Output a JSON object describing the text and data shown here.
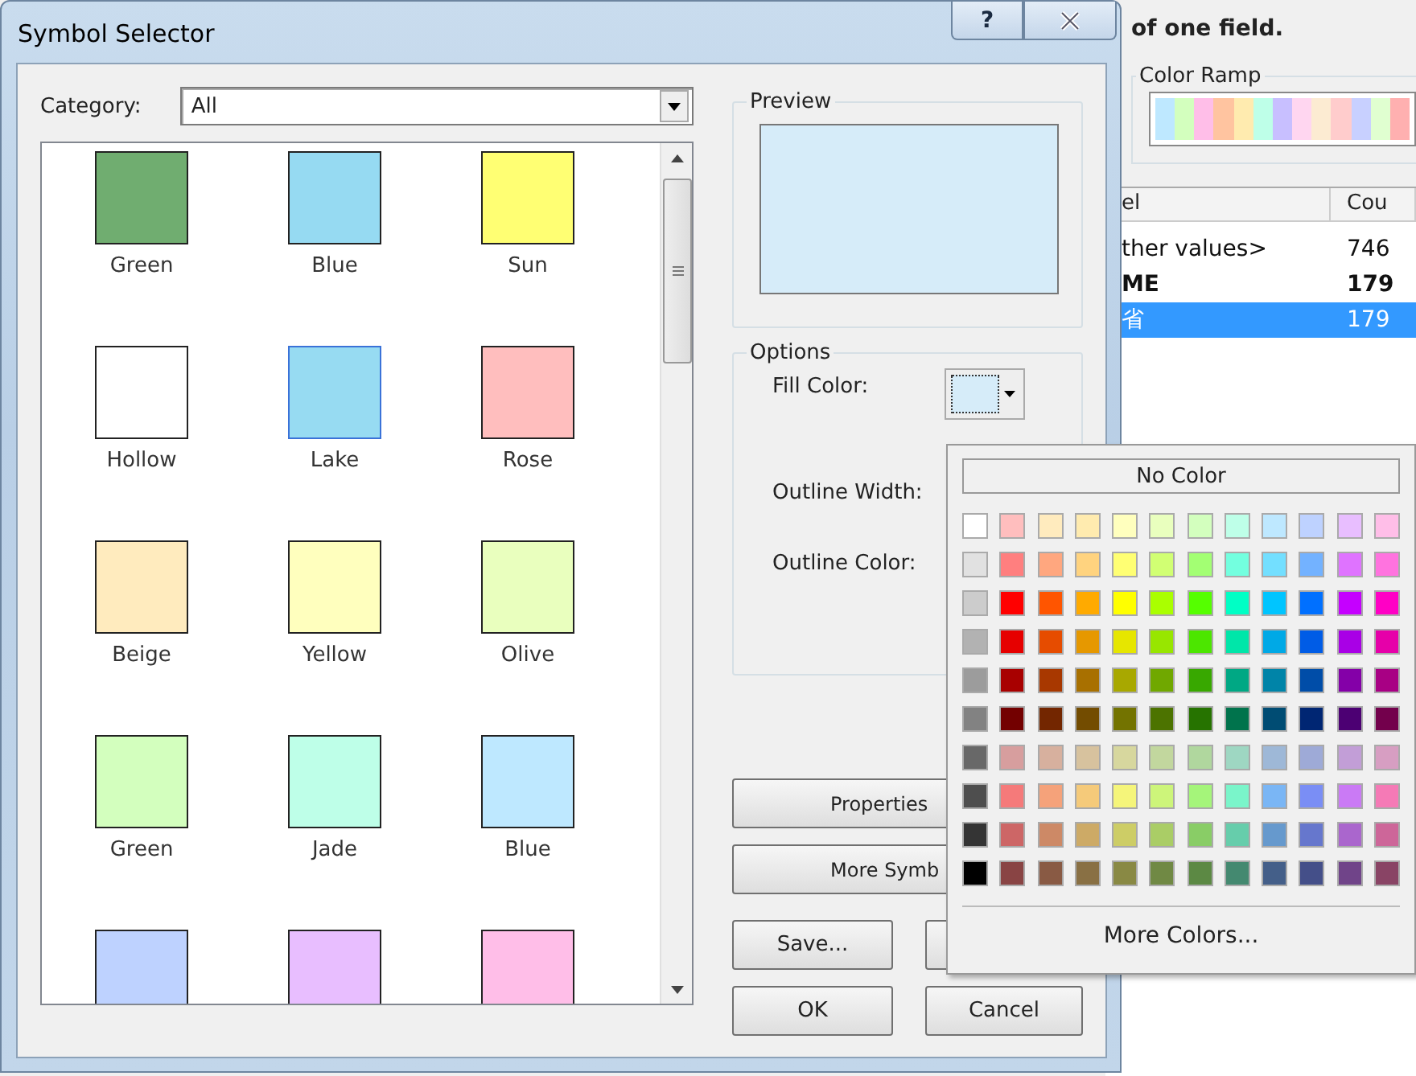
{
  "dialog": {
    "title": "Symbol Selector",
    "help_button": "?",
    "category": {
      "label": "Category:",
      "value": "All"
    },
    "symbols": [
      {
        "label": "Green",
        "color": "#70ad70",
        "selected": false
      },
      {
        "label": "Blue",
        "color": "#96daf2",
        "selected": false
      },
      {
        "label": "Sun",
        "color": "#ffff73",
        "selected": false
      },
      {
        "label": "Hollow",
        "color": "#ffffff",
        "selected": false
      },
      {
        "label": "Lake",
        "color": "#97dbf2",
        "selected": true
      },
      {
        "label": "Rose",
        "color": "#ffbebe",
        "selected": false
      },
      {
        "label": "Beige",
        "color": "#ffebbe",
        "selected": false
      },
      {
        "label": "Yellow",
        "color": "#ffffbe",
        "selected": false
      },
      {
        "label": "Olive",
        "color": "#e9ffbe",
        "selected": false
      },
      {
        "label": "Green",
        "color": "#d3ffbe",
        "selected": false
      },
      {
        "label": "Jade",
        "color": "#beffe8",
        "selected": false
      },
      {
        "label": "Blue",
        "color": "#bee8ff",
        "selected": false
      },
      {
        "color": "#bed2ff",
        "selected": false
      },
      {
        "color": "#e8beff",
        "selected": false
      },
      {
        "color": "#ffbee8",
        "selected": false
      }
    ],
    "preview": {
      "title": "Preview"
    },
    "options": {
      "title": "Options",
      "fill_color": {
        "label": "Fill Color:",
        "color": "#d6ecf9"
      },
      "outline_width": {
        "label": "Outline Width:"
      },
      "outline_color": {
        "label": "Outline Color:"
      }
    },
    "buttons": [
      {
        "label": "Properties"
      },
      {
        "label": "More Symb"
      },
      {
        "label": "Save..."
      },
      {
        "label": "OK"
      },
      {
        "label": "Cancel"
      }
    ]
  },
  "color_palette": {
    "no_color": "No Color",
    "more_colors": "More Colors...",
    "rows": [
      [
        {
          "color": "#ffffff"
        },
        {
          "color": "#ffbebe"
        },
        {
          "color": "#ffebbe"
        },
        {
          "color": "#ffebaf"
        },
        {
          "color": "#ffffbe"
        },
        {
          "color": "#e9ffbe"
        },
        {
          "color": "#d3ffbe"
        },
        {
          "color": "#beffe8"
        },
        {
          "color": "#bee8ff"
        },
        {
          "color": "#bed2ff"
        },
        {
          "color": "#e8beff"
        },
        {
          "color": "#ffbee8"
        }
      ],
      [
        {
          "color": "#e1e1e1"
        },
        {
          "color": "#ff7f7f"
        },
        {
          "color": "#ffa77f"
        },
        {
          "color": "#ffd37f"
        },
        {
          "color": "#ffff73"
        },
        {
          "color": "#d1ff73"
        },
        {
          "color": "#a3ff73"
        },
        {
          "color": "#73ffdf"
        },
        {
          "color": "#73dfff"
        },
        {
          "color": "#73b2ff"
        },
        {
          "color": "#df73ff"
        },
        {
          "color": "#ff73df"
        }
      ],
      [
        {
          "color": "#cccccc"
        },
        {
          "color": "#ff0000"
        },
        {
          "color": "#ff5500"
        },
        {
          "color": "#ffaa00"
        },
        {
          "color": "#ffff00"
        },
        {
          "color": "#aaff00"
        },
        {
          "color": "#55ff00"
        },
        {
          "color": "#00ffc5"
        },
        {
          "color": "#00c5ff"
        },
        {
          "color": "#0070ff"
        },
        {
          "color": "#c500ff"
        },
        {
          "color": "#ff00c5"
        }
      ],
      [
        {
          "color": "#b2b2b2"
        },
        {
          "color": "#e60000"
        },
        {
          "color": "#e64c00"
        },
        {
          "color": "#e69800"
        },
        {
          "color": "#e6e600"
        },
        {
          "color": "#98e600"
        },
        {
          "color": "#4ce600"
        },
        {
          "color": "#00e6a9"
        },
        {
          "color": "#00a9e6"
        },
        {
          "color": "#005ce6"
        },
        {
          "color": "#a900e6"
        },
        {
          "color": "#e600a9"
        }
      ],
      [
        {
          "color": "#9c9c9c"
        },
        {
          "color": "#a80000"
        },
        {
          "color": "#a83800"
        },
        {
          "color": "#a87000"
        },
        {
          "color": "#a8a800"
        },
        {
          "color": "#70a800"
        },
        {
          "color": "#38a800"
        },
        {
          "color": "#00a884"
        },
        {
          "color": "#0084a8"
        },
        {
          "color": "#004da8"
        },
        {
          "color": "#8400a8"
        },
        {
          "color": "#a80084"
        }
      ],
      [
        {
          "color": "#828282"
        },
        {
          "color": "#730000"
        },
        {
          "color": "#732600"
        },
        {
          "color": "#734c00"
        },
        {
          "color": "#737300"
        },
        {
          "color": "#4c7300"
        },
        {
          "color": "#267300"
        },
        {
          "color": "#00734c"
        },
        {
          "color": "#004c73"
        },
        {
          "color": "#002673"
        },
        {
          "color": "#4c0073"
        },
        {
          "color": "#73004c"
        }
      ],
      [
        {
          "color": "#686868"
        },
        {
          "color": "#d79e9e"
        },
        {
          "color": "#d7b09e"
        },
        {
          "color": "#d7c29e"
        },
        {
          "color": "#d7d79e"
        },
        {
          "color": "#c2d79e"
        },
        {
          "color": "#b0d79e"
        },
        {
          "color": "#9ed7c2"
        },
        {
          "color": "#9eb8d7"
        },
        {
          "color": "#9eaad7"
        },
        {
          "color": "#c29ed7"
        },
        {
          "color": "#d79ec2"
        }
      ],
      [
        {
          "color": "#4e4e4e"
        },
        {
          "color": "#f57a7a"
        },
        {
          "color": "#f5a27a"
        },
        {
          "color": "#f5ca7a"
        },
        {
          "color": "#f5f57a"
        },
        {
          "color": "#cdf57a"
        },
        {
          "color": "#a5f57a"
        },
        {
          "color": "#7af5ca"
        },
        {
          "color": "#7ab6f5"
        },
        {
          "color": "#7a8ef5"
        },
        {
          "color": "#ca7af5"
        },
        {
          "color": "#f57ab6"
        }
      ],
      [
        {
          "color": "#343434"
        },
        {
          "color": "#cd6666"
        },
        {
          "color": "#cd8966"
        },
        {
          "color": "#cdaa66"
        },
        {
          "color": "#cdcd66"
        },
        {
          "color": "#aacd66"
        },
        {
          "color": "#89cd66"
        },
        {
          "color": "#66cdab"
        },
        {
          "color": "#6699cd"
        },
        {
          "color": "#6677cd"
        },
        {
          "color": "#aa66cd"
        },
        {
          "color": "#cd6699"
        }
      ],
      [
        {
          "color": "#000000"
        },
        {
          "color": "#894444"
        },
        {
          "color": "#895a44"
        },
        {
          "color": "#897044"
        },
        {
          "color": "#898944"
        },
        {
          "color": "#708944"
        },
        {
          "color": "#5c8944"
        },
        {
          "color": "#448970"
        },
        {
          "color": "#445f89"
        },
        {
          "color": "#444f89"
        },
        {
          "color": "#704489"
        },
        {
          "color": "#894465"
        }
      ]
    ]
  },
  "background_window": {
    "heading": "of one field.",
    "color_ramp": {
      "title": "Color Ramp"
    },
    "table": {
      "columns": [
        "el",
        "Cou"
      ],
      "rows": [
        {
          "cells": [
            "ther values>",
            "746"
          ],
          "bold": false,
          "selected": false
        },
        {
          "cells": [
            "ME",
            "179"
          ],
          "bold": true,
          "selected": false
        },
        {
          "cells": [
            "省",
            "179"
          ],
          "bold": false,
          "selected": true
        }
      ]
    }
  }
}
